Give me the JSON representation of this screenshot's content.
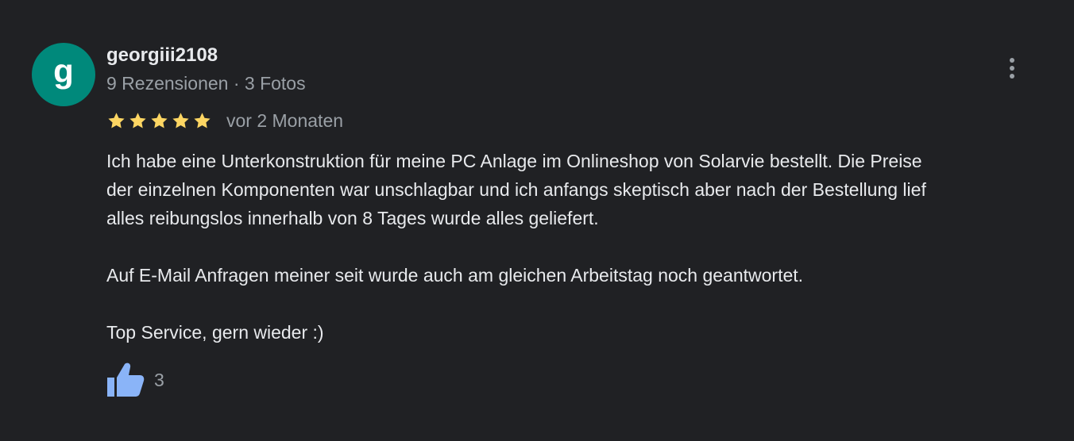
{
  "reviewer": {
    "avatar_letter": "g",
    "avatar_color": "#00897b",
    "name": "georgiii2108",
    "meta": "9 Rezensionen · 3 Fotos"
  },
  "menu": {
    "icon": "more-vert-icon"
  },
  "rating": {
    "stars": 5,
    "star_color": "#fdd663",
    "date": "vor 2 Monaten"
  },
  "review": {
    "lines_1": [
      "Ich habe eine Unterkonstruktion für meine PC Anlage im Onlineshop von Solarvie bestellt. Die Preise",
      "der einzelnen Komponenten war unschlagbar und ich anfangs skeptisch aber nach der Bestellung lief",
      "alles reibungslos innerhalb von 8 Tages wurde alles geliefert."
    ],
    "paragraph_2": "Auf E-Mail Anfragen meiner seit wurde auch am gleichen Arbeitstag noch geantwortet.",
    "paragraph_3": "Top Service, gern wieder :)"
  },
  "like": {
    "icon": "thumbs-up-icon",
    "color": "#8ab4f8",
    "count": "3"
  }
}
